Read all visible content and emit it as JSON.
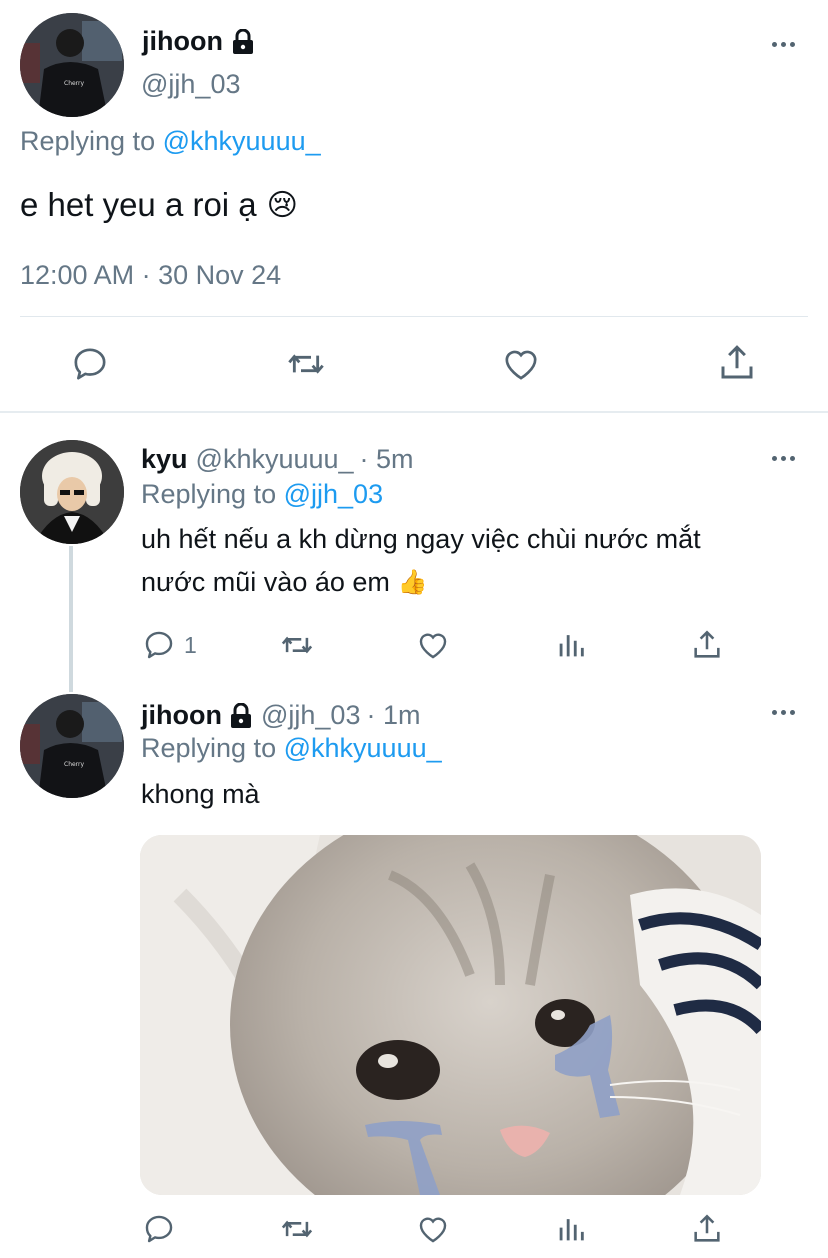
{
  "main_tweet": {
    "display_name": "jihoon",
    "handle": "@jjh_03",
    "replying_prefix": "Replying to",
    "replying_to": "@khkyuuuu_",
    "text": "e het yeu a roi ạ",
    "emoji": "😢",
    "timestamp": "12:00 AM · 30 Nov 24",
    "actions": [
      "reply-icon",
      "retweet-icon",
      "like-icon",
      "share-icon"
    ]
  },
  "reply1": {
    "display_name": "kyu",
    "handle": "@khkyuuuu_",
    "time": "· 5m",
    "replying_prefix": "Replying to",
    "replying_to": "@jjh_03",
    "text_line1": "uh hết nếu a kh dừng ngay việc chùi nước mắt",
    "text_line2": "nước mũi vào áo em",
    "emoji": "👍",
    "reply_count": "1"
  },
  "reply2": {
    "display_name": "jihoon",
    "handle": "@jjh_03",
    "time": "· 1m",
    "replying_prefix": "Replying to",
    "replying_to": "@khkyuuuu_",
    "text": "khong mà",
    "media": "crying-kitten-photo"
  },
  "colors": {
    "link": "#1d9bf0",
    "secondary": "#657786",
    "divider": "#e1e8ed",
    "icon": "#536471"
  }
}
